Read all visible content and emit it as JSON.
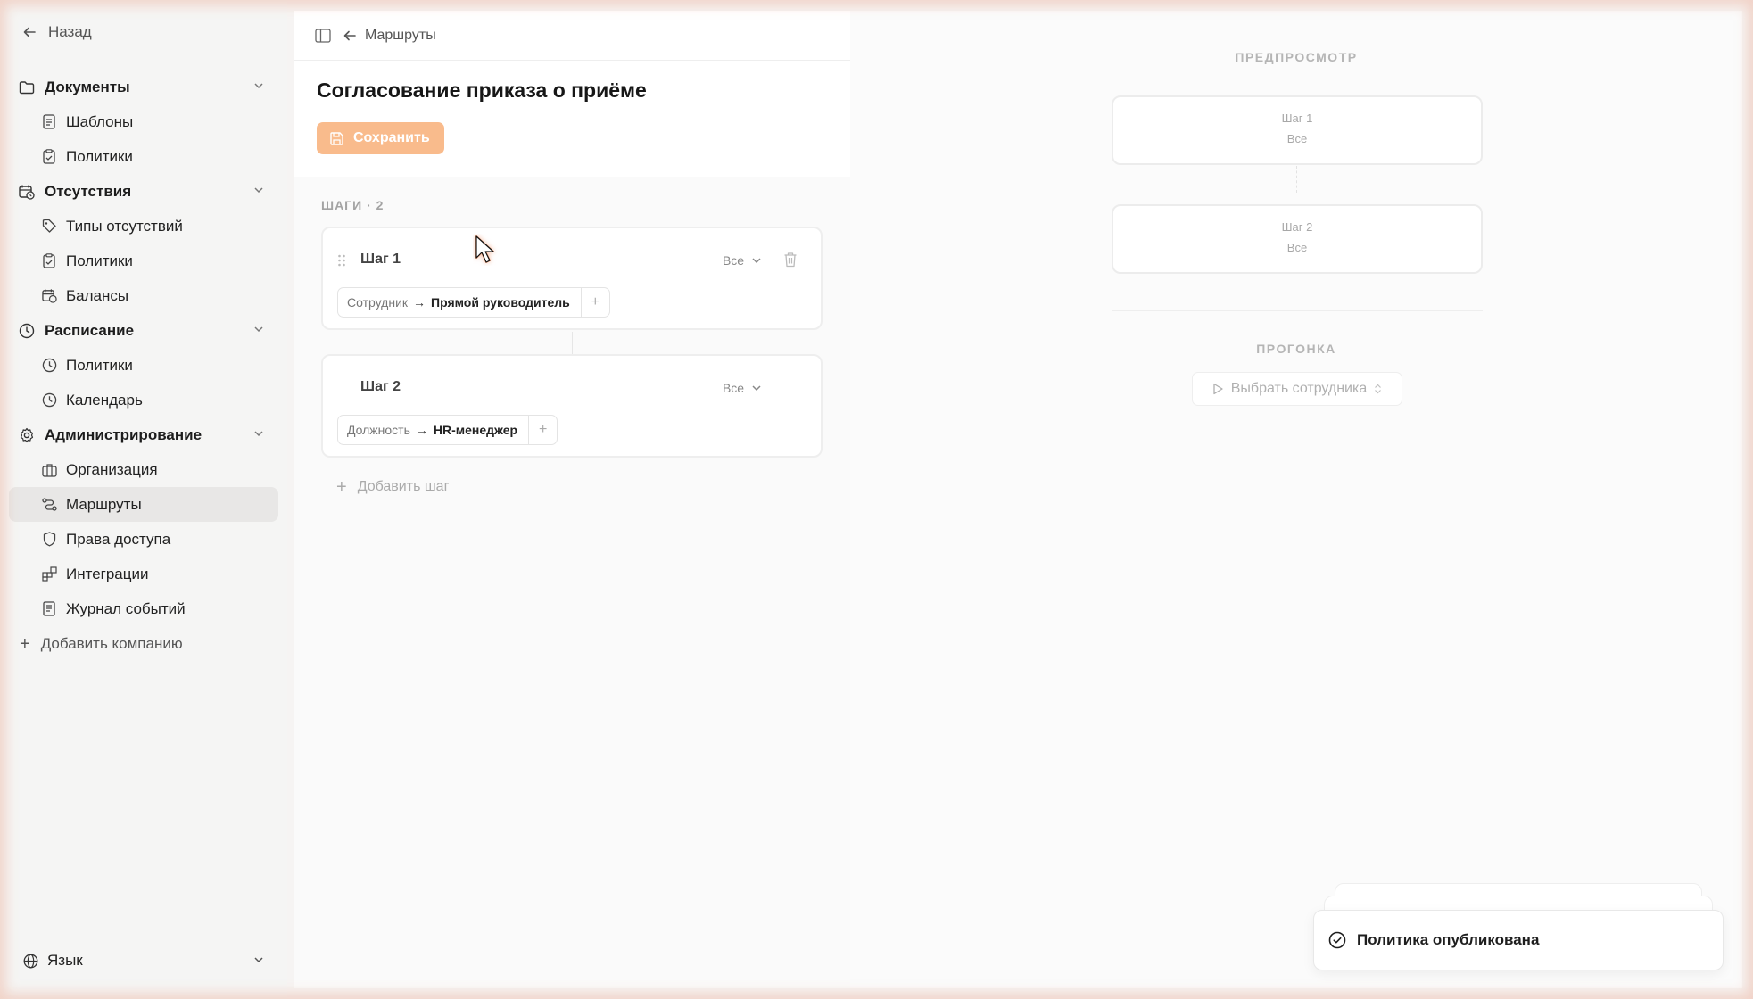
{
  "sidebar": {
    "back_label": "Назад",
    "groups": [
      {
        "label": "Документы",
        "icon": "folder-icon",
        "items": [
          {
            "label": "Шаблоны",
            "icon": "file-text-icon"
          },
          {
            "label": "Политики",
            "icon": "clipboard-check-icon"
          }
        ]
      },
      {
        "label": "Отсутствия",
        "icon": "calendar-clock-icon",
        "items": [
          {
            "label": "Типы отсутствий",
            "icon": "tag-icon"
          },
          {
            "label": "Политики",
            "icon": "clipboard-check-icon"
          },
          {
            "label": "Балансы",
            "icon": "calendar-clock-icon"
          }
        ]
      },
      {
        "label": "Расписание",
        "icon": "clock-icon",
        "items": [
          {
            "label": "Политики",
            "icon": "clock-icon"
          },
          {
            "label": "Календарь",
            "icon": "clock-icon"
          }
        ]
      },
      {
        "label": "Администрирование",
        "icon": "gear-icon",
        "items": [
          {
            "label": "Организация",
            "icon": "briefcase-icon"
          },
          {
            "label": "Маршруты",
            "icon": "route-icon",
            "active": true
          },
          {
            "label": "Права доступа",
            "icon": "shield-icon"
          },
          {
            "label": "Интеграции",
            "icon": "blocks-icon"
          },
          {
            "label": "Журнал событий",
            "icon": "logs-icon"
          }
        ]
      }
    ],
    "add_company_label": "Добавить компанию",
    "language_label": "Язык"
  },
  "editor": {
    "breadcrumb": "Маршруты",
    "title": "Согласование приказа о приёме",
    "save_label": "Сохранить",
    "steps_label": "ШАГИ · 2",
    "steps": [
      {
        "name": "Шаг 1",
        "mode": "Все",
        "source": "Сотрудник",
        "target": "Прямой руководитель"
      },
      {
        "name": "Шаг 2",
        "mode": "Все",
        "source": "Должность",
        "target": "HR-менеджер"
      }
    ],
    "add_step_label": "Добавить шаг"
  },
  "preview": {
    "label": "ПРЕДПРОСМОТР",
    "cards": [
      {
        "name": "Шаг 1",
        "mode": "Все"
      },
      {
        "name": "Шаг 2",
        "mode": "Все"
      }
    ],
    "run_label": "ПРОГОНКА",
    "pick_employee_label": "Выбрать сотрудника"
  },
  "toast": {
    "message": "Политика опубликована"
  },
  "colors": {
    "accent": "#f9bb8c",
    "active_item_bg": "#e8e7e6"
  }
}
